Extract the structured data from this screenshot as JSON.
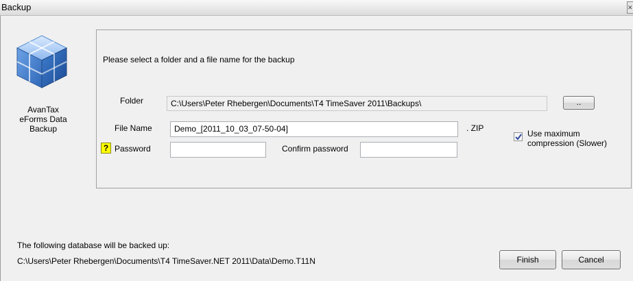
{
  "window": {
    "title": "Backup",
    "close_icon": "close-icon"
  },
  "app": {
    "name_line1": "AvanTax",
    "name_line2": "eForms Data",
    "name_line3": "Backup",
    "icon": "database-cubes-icon"
  },
  "form": {
    "instruction": "Please select a folder and a file name for the backup",
    "folder_label": "Folder",
    "folder_value": "C:\\Users\\Peter Rhebergen\\Documents\\T4 TimeSaver 2011\\Backups\\",
    "browse_label": "..",
    "filename_label": "File Name",
    "filename_value": "Demo_[2011_10_03_07-50-04]",
    "extension": ". ZIP",
    "help_label": "?",
    "password_label": "Password",
    "password_value": "",
    "confirm_label": "Confirm password",
    "confirm_value": "",
    "compression_label_line1": "Use maximum",
    "compression_label_line2": "compression (Slower)",
    "compression_checked": true
  },
  "footer": {
    "database_label": "The following database will be backed up:",
    "database_path": "C:\\Users\\Peter Rhebergen\\Documents\\T4 TimeSaver.NET 2011\\Data\\Demo.T11N",
    "finish_label": "Finish",
    "cancel_label": "Cancel"
  },
  "colors": {
    "help_badge": "#ffff00",
    "checkmark": "#2a4a9a",
    "icon_blue": "#3a78c8"
  }
}
